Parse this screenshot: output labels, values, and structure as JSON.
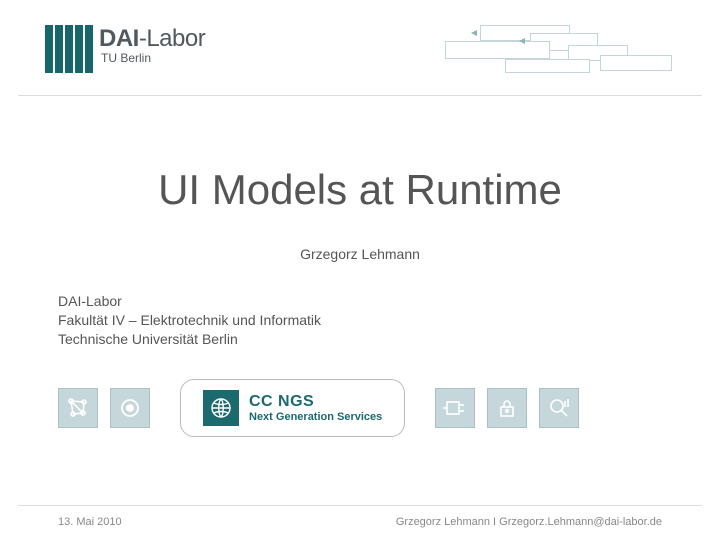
{
  "logo": {
    "name_bold": "DAI",
    "name_light": "-Labor",
    "subtitle": "TU Berlin"
  },
  "title": "UI Models at Runtime",
  "author": "Grzegorz Lehmann",
  "affiliation": {
    "line1": "DAI-Labor",
    "line2": "Fakultät IV – Elektrotechnik und Informatik",
    "line3": "Technische Universität Berlin"
  },
  "center_badge": {
    "line1": "CC NGS",
    "line2": "Next Generation Services"
  },
  "footer": {
    "date": "13. Mai 2010",
    "contact": "Grzegorz Lehmann I  Grzegorz.Lehmann@dai-labor.de"
  }
}
